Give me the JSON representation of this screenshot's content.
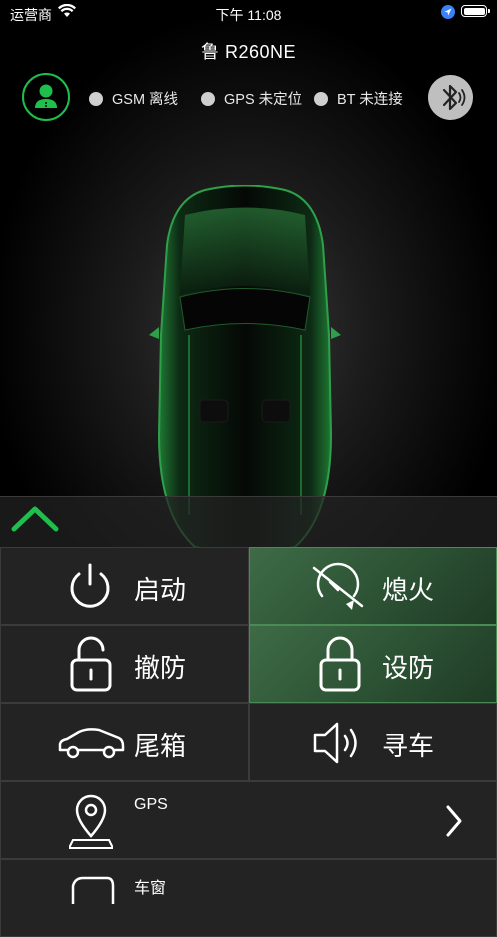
{
  "status_bar": {
    "carrier": "运营商",
    "time": "下午 11:08"
  },
  "header": {
    "plate": "鲁 R260NE"
  },
  "connection": {
    "gsm": "GSM 离线",
    "gps": "GPS 未定位",
    "bt": "BT 未连接"
  },
  "controls": {
    "start": "启动",
    "stop": "熄火",
    "disarm": "撤防",
    "arm": "设防",
    "trunk": "尾箱",
    "find": "寻车"
  },
  "list": {
    "gps_label": "GPS",
    "window_label": "车窗"
  },
  "colors": {
    "accent": "#1fbf4d",
    "active_cell": "#2c5234"
  }
}
